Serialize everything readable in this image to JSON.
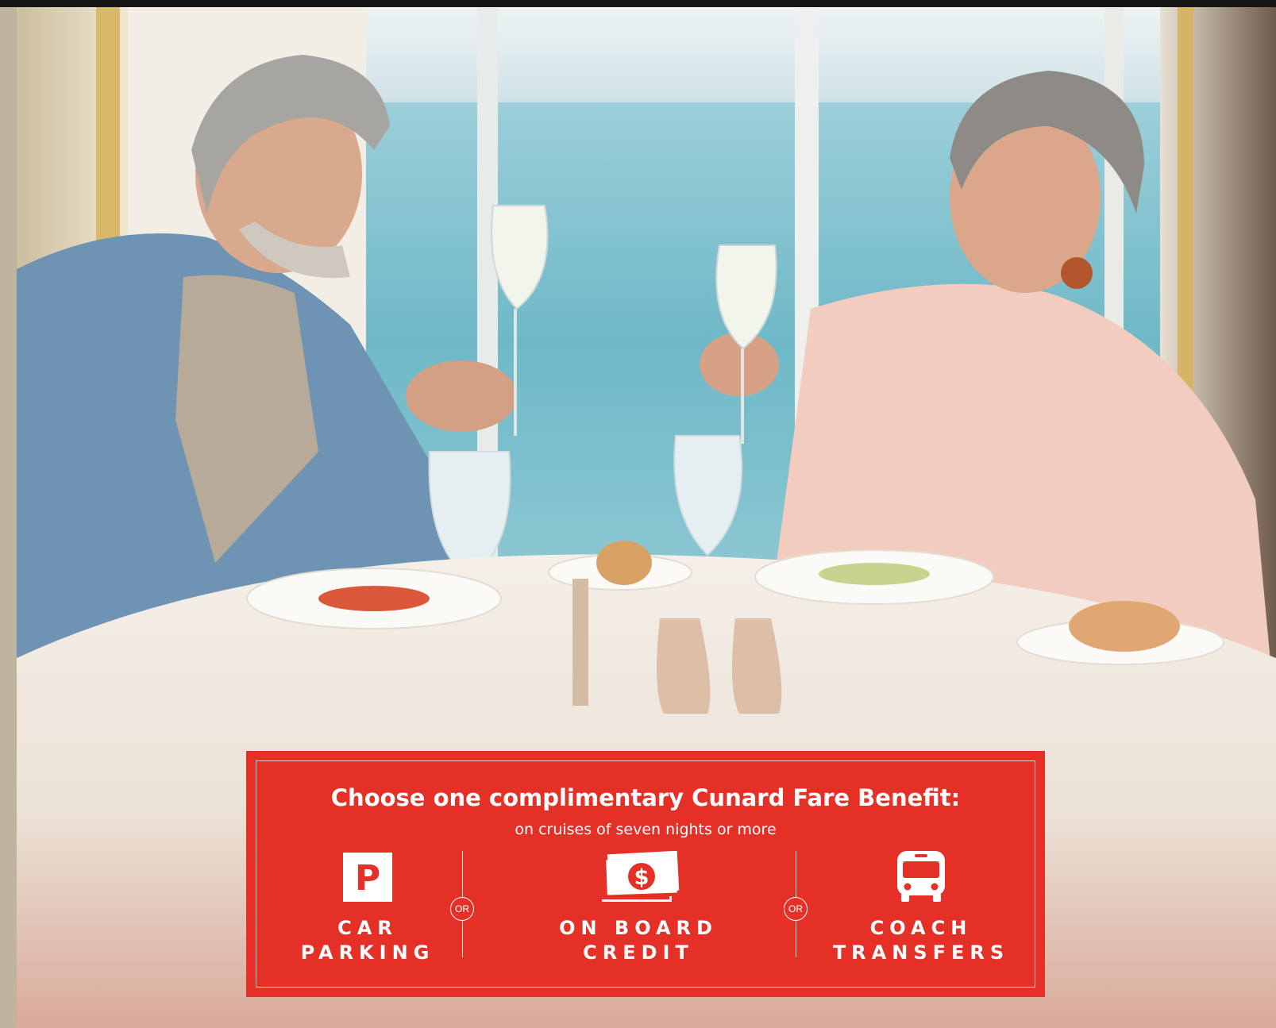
{
  "banner": {
    "headline": "Choose one complimentary Cunard Fare Benefit:",
    "subline": "on cruises of seven nights or more",
    "separator": "OR",
    "options": [
      {
        "label_line1": "CAR",
        "label_line2": "PARKING",
        "icon": "parking-icon"
      },
      {
        "label_line1": "ON BOARD",
        "label_line2": "CREDIT",
        "icon": "money-credit-icon"
      },
      {
        "label_line1": "COACH",
        "label_line2": "TRANSFERS",
        "icon": "bus-icon"
      }
    ],
    "colors": {
      "background": "#e53027",
      "text": "#ffffff"
    }
  },
  "icons": {
    "parking_letter": "P",
    "credit_symbol": "$"
  }
}
